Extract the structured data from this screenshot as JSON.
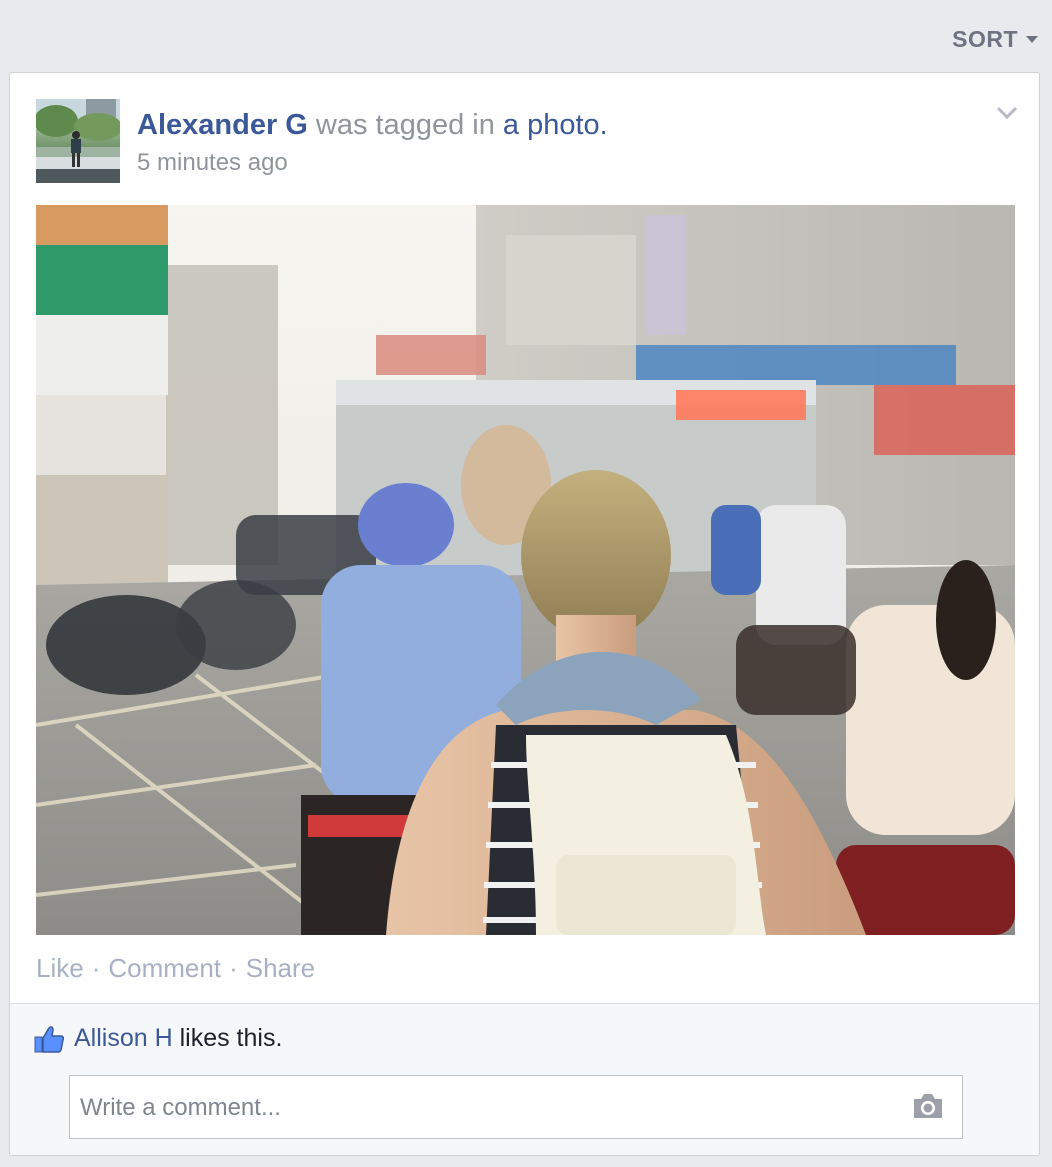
{
  "toolbar": {
    "sort_label": "SORT"
  },
  "post": {
    "author": "Alexander G",
    "action_text": " was tagged in ",
    "object_link": "a photo.",
    "timestamp": "5 minutes ago",
    "actions": {
      "like": "Like",
      "comment": "Comment",
      "share": "Share",
      "separator": "·"
    }
  },
  "likes": {
    "liker": "Allison H",
    "suffix": " likes this."
  },
  "comment_box": {
    "placeholder": "Write a comment..."
  },
  "icons": {
    "sort": "chevron-down-icon",
    "options": "chevron-down-icon",
    "like": "thumbs-up-icon",
    "camera": "camera-icon"
  },
  "colors": {
    "link": "#3b5998",
    "meta": "#90949c",
    "background": "#e9eaed"
  }
}
